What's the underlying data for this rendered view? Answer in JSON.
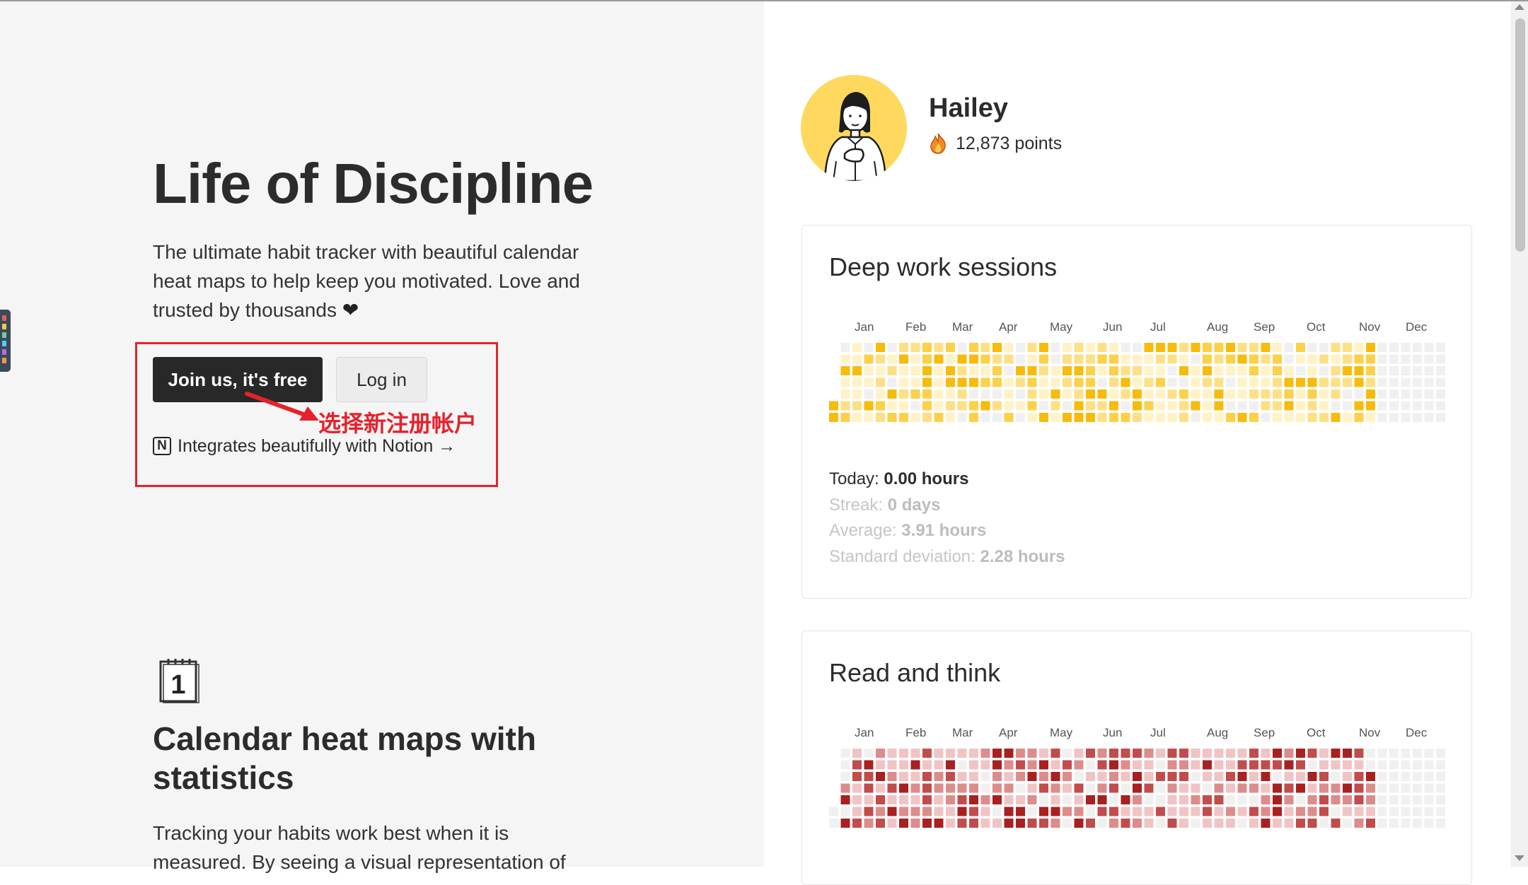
{
  "hero": {
    "title": "Life of Discipline",
    "tagline": "The ultimate habit tracker with beautiful calendar heat maps to help keep you motivated. Love and trusted by thousands",
    "tagline_heart": "❤",
    "join_button": "Join us, it's free",
    "login_button": "Log in",
    "notion_icon_letter": "N",
    "notion_link": "Integrates beautifully with Notion →"
  },
  "annotation": {
    "text": "选择新注册帐户",
    "color": "#e5222b"
  },
  "feature": {
    "calendar_icon_number": "1",
    "title": "Calendar heat maps with statistics",
    "text": "Tracking your habits work best when it is measured. By seeing a visual representation of"
  },
  "profile": {
    "name": "Hailey",
    "points": "12,873 points",
    "points_icon": "flame-icon"
  },
  "months": [
    "Jan",
    "Feb",
    "Mar",
    "Apr",
    "May",
    "Jun",
    "Jul",
    "Aug",
    "Sep",
    "Oct",
    "Nov",
    "Dec"
  ],
  "cards": [
    {
      "title": "Deep work sessions",
      "palette": [
        "#f0f0f0",
        "#fff2c6",
        "#fde086",
        "#fcd048",
        "#f7bb0c"
      ],
      "stats": {
        "today_label": "Today:",
        "today_value": "0.00 hours",
        "streak_label": "Streak:",
        "streak_value": "0 days",
        "average_label": "Average:",
        "average_value": "3.91 hours",
        "std_label": "Standard deviation:",
        "std_value": "2.28 hours"
      }
    },
    {
      "title": "Read and think",
      "palette": [
        "#f0f0f0",
        "#f0c4c4",
        "#dd8c8c",
        "#c24c4c",
        "#a82020"
      ]
    }
  ],
  "colors": {
    "accent_dark": "#282828",
    "left_bg": "#f5f5f5",
    "avatar_bg": "#fed95e",
    "flame": "#f28c1c"
  }
}
